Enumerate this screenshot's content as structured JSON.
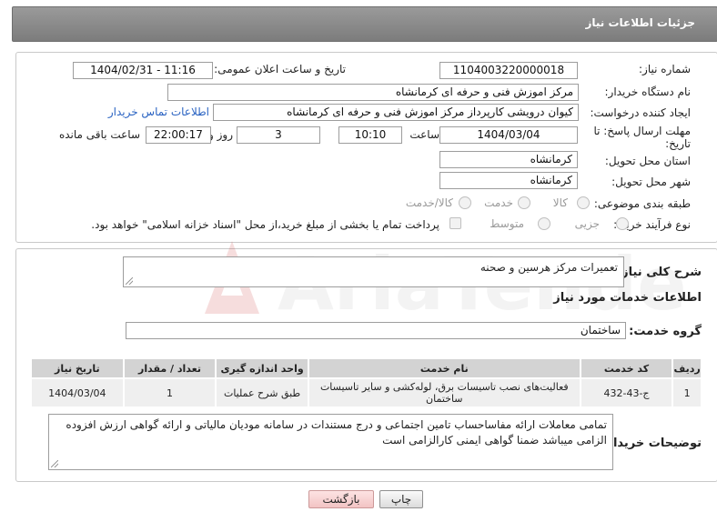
{
  "header": {
    "title": "جزئیات اطلاعات نیاز"
  },
  "form": {
    "need_number_label": "شماره نیاز:",
    "need_number": "1104003220000018",
    "announce_datetime_label": "تاریخ و ساعت اعلان عمومی:",
    "announce_datetime": "1404/02/31 - 11:16",
    "buyer_org_label": "نام دستگاه خریدار:",
    "buyer_org": "مرکز اموزش فنی و حرفه ای کرمانشاه",
    "requester_label": "ایجاد کننده درخواست:",
    "requester": "کیوان درویشی کارپرداز مرکز اموزش فنی و حرفه ای کرمانشاه",
    "buyer_contact_link": "اطلاعات تماس خریدار",
    "deadline_label_line1": "مهلت ارسال پاسخ: تا",
    "deadline_label_line2": "تاریخ:",
    "deadline_date": "1404/03/04",
    "time_label": "ساعت",
    "deadline_time": "10:10",
    "days_value": "3",
    "days_label": "روز و",
    "remaining_time": "22:00:17",
    "remaining_label": "ساعت باقی مانده",
    "province_label": "استان محل تحویل:",
    "province": "کرمانشاه",
    "city_label": "شهر محل تحویل:",
    "city": "کرمانشاه",
    "category_label": "طبقه بندی موضوعی:",
    "category_options": [
      "کالا",
      "خدمت",
      "کالا/خدمت"
    ],
    "purchase_type_label": "نوع فرآیند خرید :",
    "purchase_type_options": [
      "جزیی",
      "متوسط"
    ],
    "payment_note": "پرداخت تمام یا بخشی از مبلغ خرید،از محل \"اسناد خزانه اسلامی\" خواهد بود."
  },
  "description": {
    "label": "شرح کلی نیاز:",
    "value": "تعمیرات مرکز هرسین و صحنه"
  },
  "services": {
    "section_title": "اطلاعات خدمات مورد نیاز",
    "group_label": "گروه خدمت:",
    "group_value": "ساختمان",
    "columns": [
      "ردیف",
      "کد خدمت",
      "نام خدمت",
      "واحد اندازه گیری",
      "تعداد / مقدار",
      "تاریخ نیاز"
    ],
    "rows": [
      [
        "1",
        "ج-43-432",
        "فعالیت‌های نصب تاسیسات برق، لوله‌کشی و سایر تاسیسات ساختمان",
        "طبق شرح عملیات",
        "1",
        "1404/03/04"
      ]
    ]
  },
  "buyer_notes": {
    "label": "توضیحات خریدار:",
    "value": "تمامی معاملات ارائه مفاساحساب تامین اجتماعی و درج مستندات در سامانه مودیان مالیاتی و ارائه گواهی ارزش افزوده الزامی میباشد ضمنا گواهی ایمنی کارالزامی است"
  },
  "buttons": {
    "print": "چاپ",
    "back": "بازگشت"
  },
  "watermark": {
    "text": "AriaTender.neT"
  }
}
